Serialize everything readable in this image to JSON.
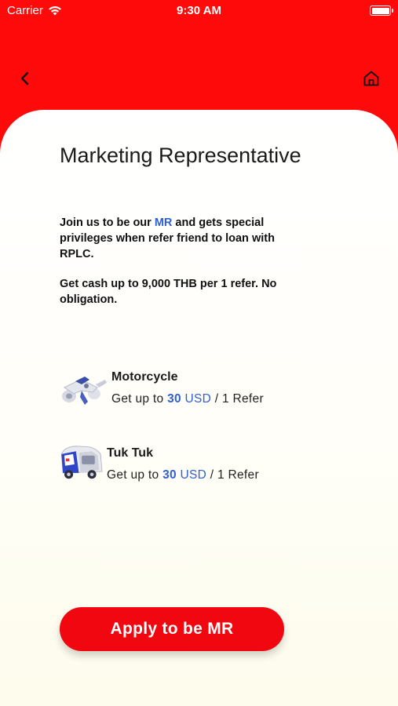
{
  "status_bar": {
    "carrier": "Carrier",
    "time": "9:30 AM",
    "battery_level": 1.0
  },
  "nav": {
    "back_icon": "chevron-left-icon",
    "home_icon": "home-icon"
  },
  "colors": {
    "brand_red": "#ff0a0a",
    "button_red": "#f0070f",
    "highlight_blue": "#2f5fd1"
  },
  "content": {
    "title": "Marketing Representative",
    "desc_pre": "Join us to be our ",
    "desc_highlight": "MR",
    "desc_post": " and gets special privileges when refer friend to loan with RPLC.",
    "desc2": "Get cash up to 9,000 THB per 1 refer. No obligation."
  },
  "vehicles": [
    {
      "name": "Motorcycle",
      "icon": "motorcycle-icon",
      "reward_prefix": "Get up to ",
      "amount": "30",
      "currency": "USD",
      "reward_suffix": " / 1 Refer"
    },
    {
      "name": "Tuk Tuk",
      "icon": "tuk-tuk-icon",
      "reward_prefix": "Get up to ",
      "amount": "30",
      "currency": "USD",
      "reward_suffix": " / 1 Refer"
    }
  ],
  "apply_button": {
    "label": "Apply to be MR"
  }
}
